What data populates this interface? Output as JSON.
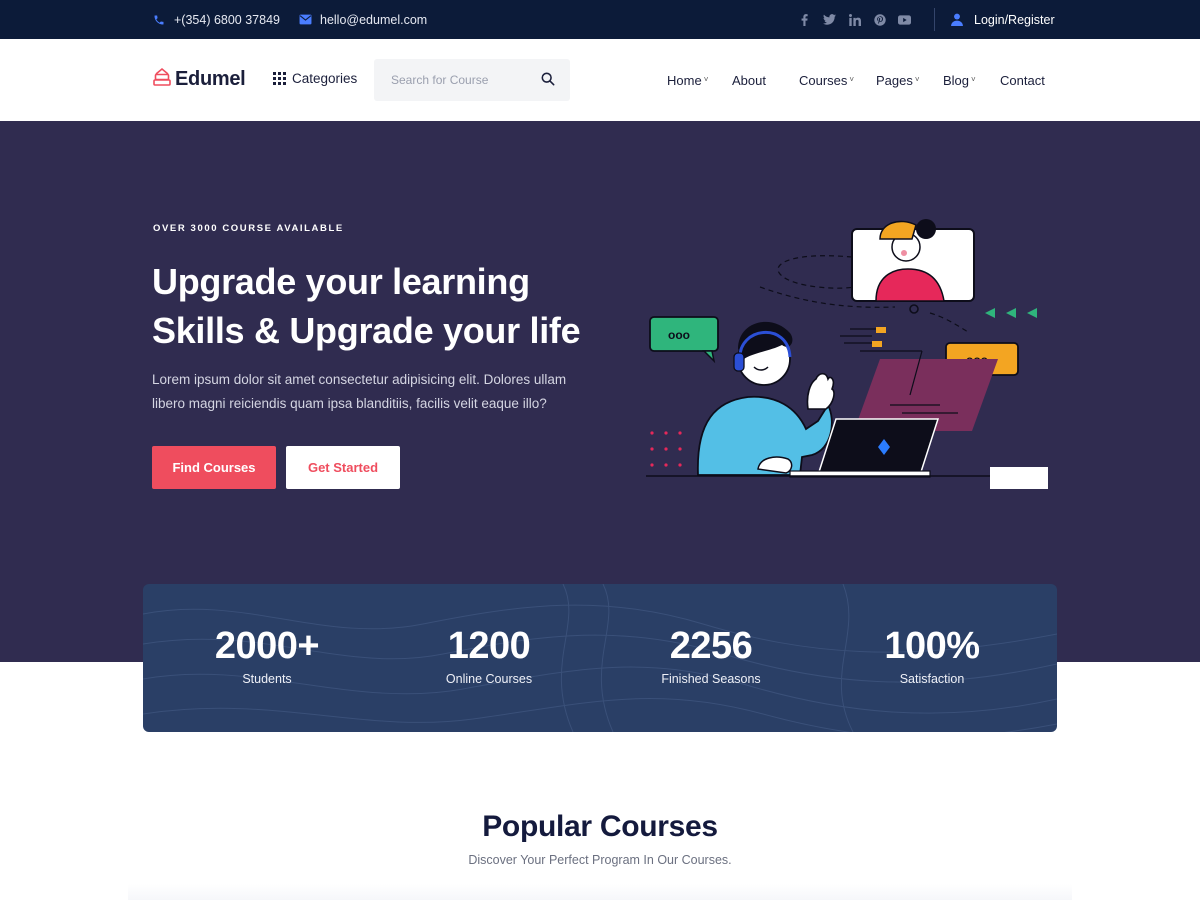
{
  "topbar": {
    "phone": "+(354) 6800 37849",
    "email": "hello@edumel.com",
    "socials": [
      "facebook-icon",
      "twitter-icon",
      "linkedin-icon",
      "pinterest-icon",
      "youtube-icon"
    ],
    "login": "Login/Register"
  },
  "header": {
    "logo": "Edumel",
    "categories": "Categories",
    "search_placeholder": "Search for Course",
    "nav": [
      {
        "label": "Home",
        "caret": "˅"
      },
      {
        "label": "About",
        "caret": ""
      },
      {
        "label": "Courses",
        "caret": "˅"
      },
      {
        "label": "Pages",
        "caret": "˅"
      },
      {
        "label": "Blog",
        "caret": "˅"
      },
      {
        "label": "Contact",
        "caret": ""
      }
    ]
  },
  "hero": {
    "eyebrow": "OVER 3000 COURSE AVAILABLE",
    "title_line1": "Upgrade your learning",
    "title_line2": "Skills & Upgrade your life",
    "description": "Lorem ipsum dolor sit amet consectetur adipisicing elit. Dolores ullam libero magni reiciendis quam ipsa blanditiis, facilis velit eaque illo?",
    "btn_find": "Find Courses",
    "btn_start": "Get Started"
  },
  "stats": [
    {
      "number": "2000+",
      "label": "Students"
    },
    {
      "number": "1200",
      "label": "Online Courses"
    },
    {
      "number": "2256",
      "label": "Finished Seasons"
    },
    {
      "number": "100%",
      "label": "Satisfaction"
    }
  ],
  "popular": {
    "title": "Popular Courses",
    "subtitle": "Discover Your Perfect Program In Our Courses."
  },
  "colors": {
    "topbar_bg": "#0c1b39",
    "hero_bg": "#302c50",
    "stats_bg": "#2a3f66",
    "accent": "#ef4d5e",
    "heading": "#141a3d"
  }
}
